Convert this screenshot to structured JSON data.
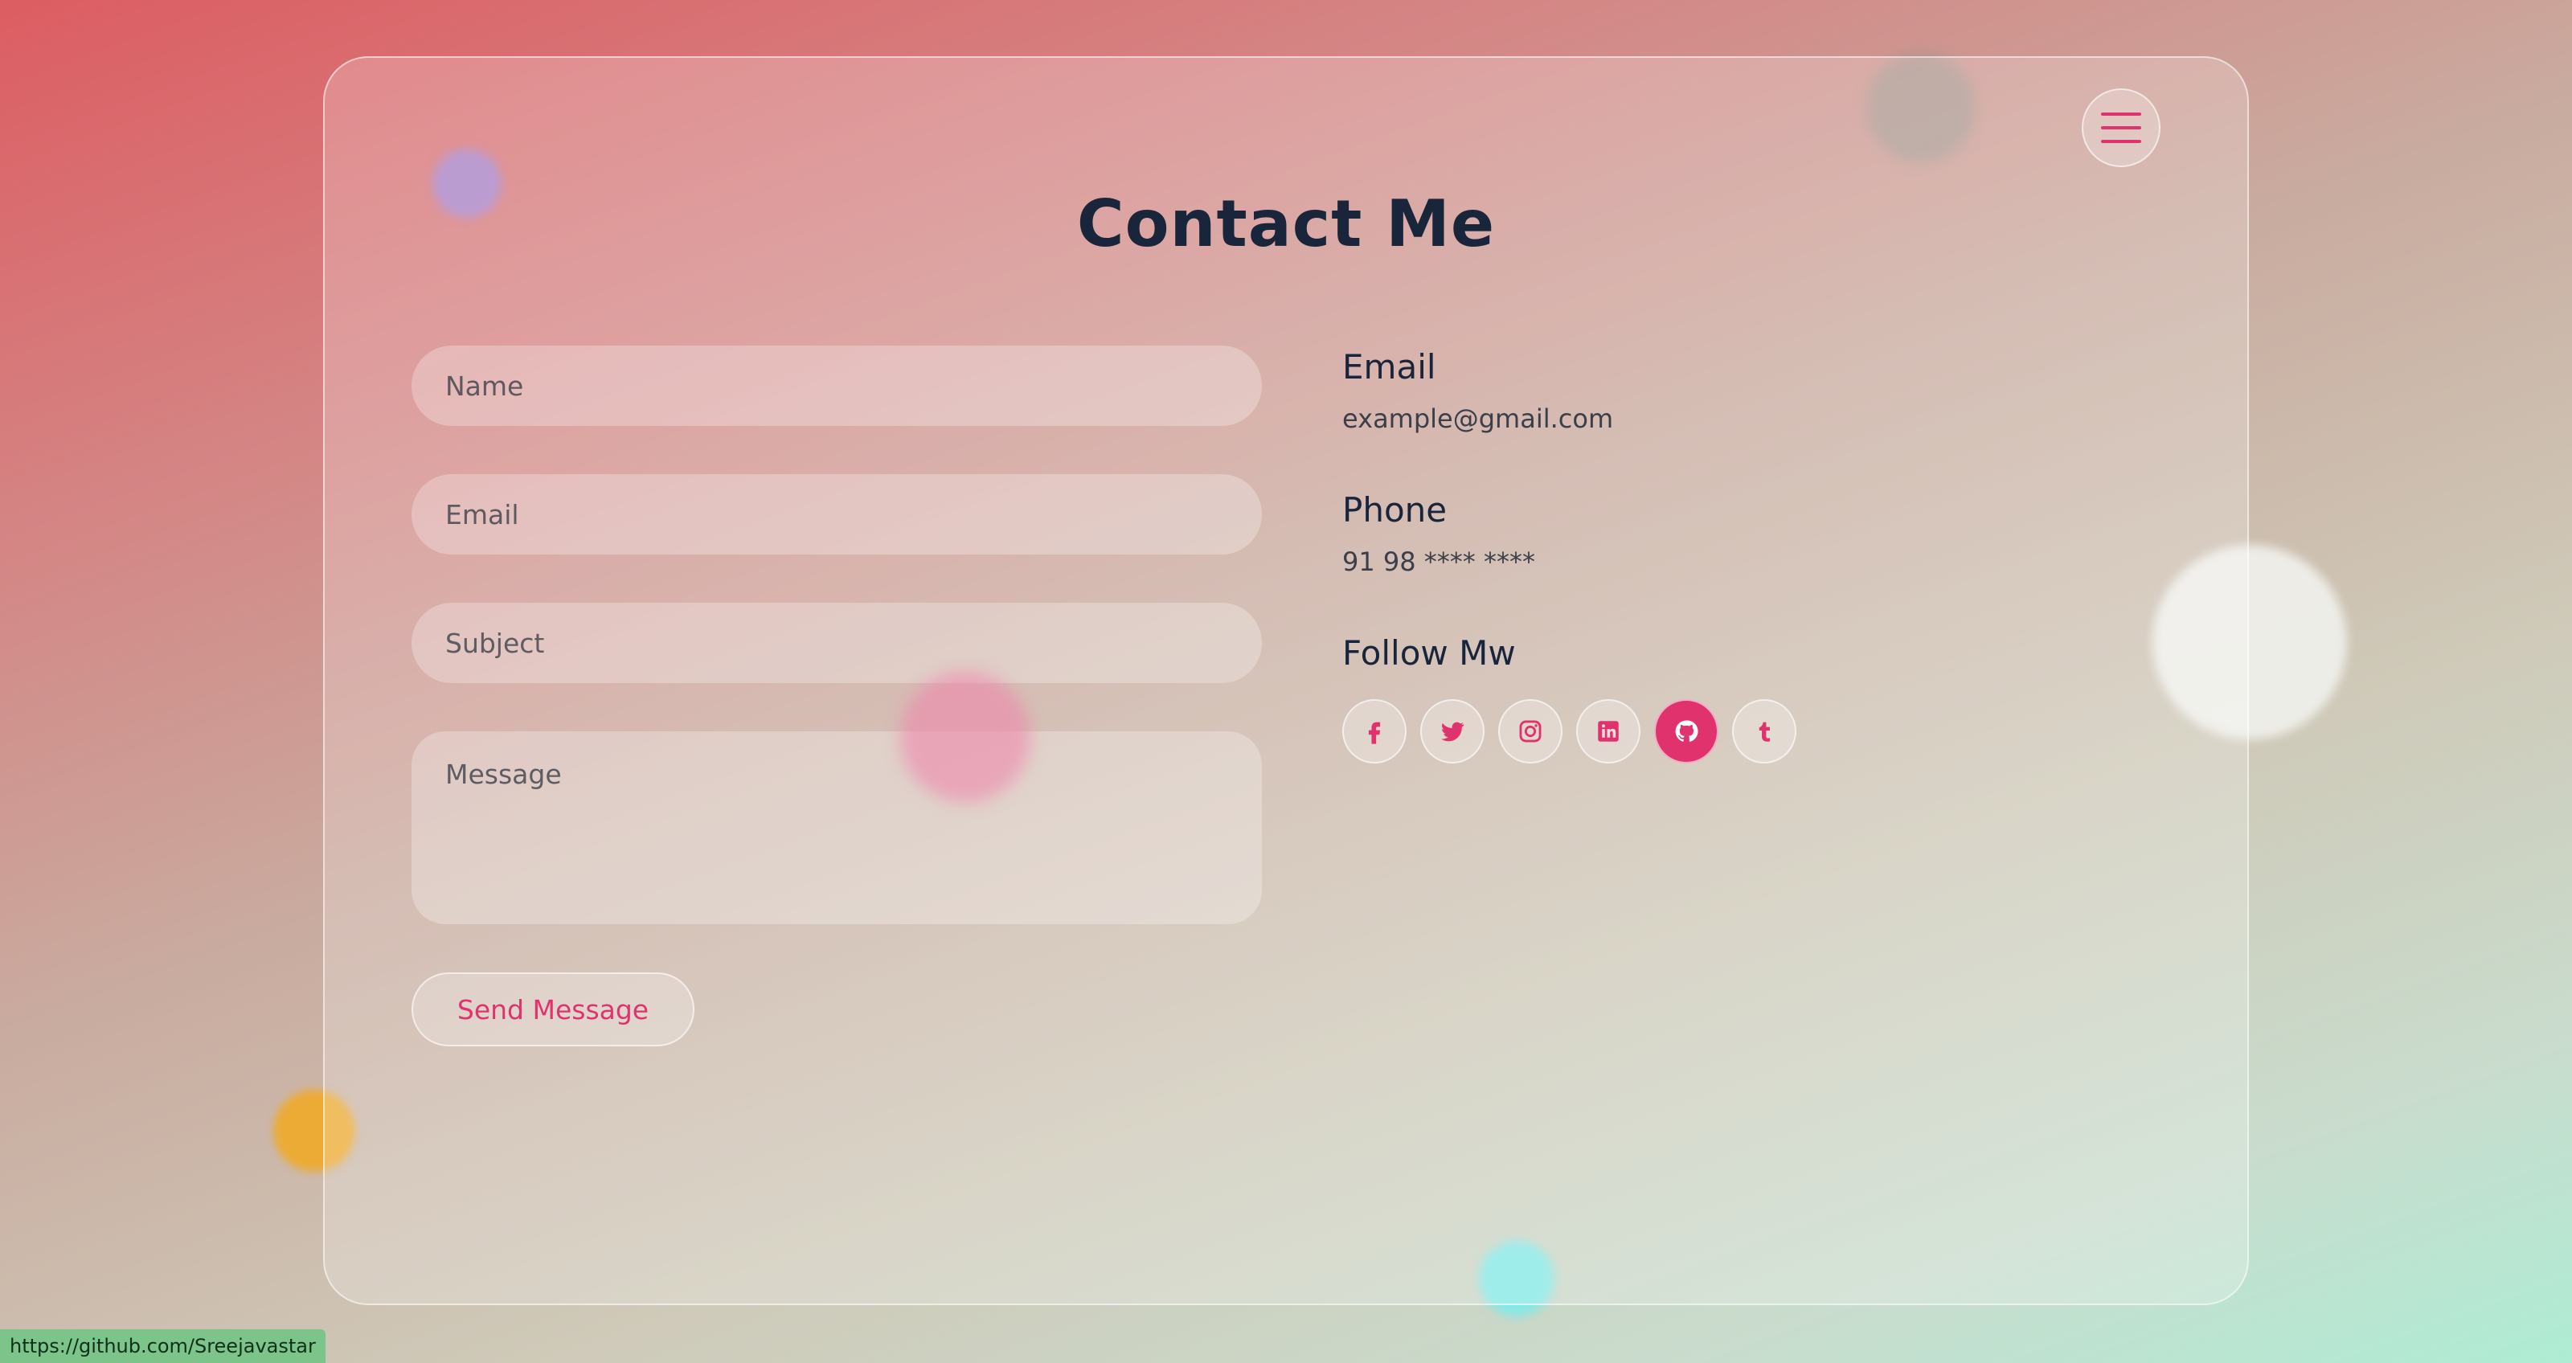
{
  "header": {
    "title": "Contact Me"
  },
  "form": {
    "name_placeholder": "Name",
    "email_placeholder": "Email",
    "subject_placeholder": "Subject",
    "message_placeholder": "Message",
    "submit_label": "Send Message"
  },
  "contact_info": {
    "email_heading": "Email",
    "email_value": "example@gmail.com",
    "phone_heading": "Phone",
    "phone_value": "91 98 **** ****",
    "follow_heading": "Follow Mw"
  },
  "social": [
    {
      "icon": "facebook-icon",
      "active": false
    },
    {
      "icon": "twitter-icon",
      "active": false
    },
    {
      "icon": "instagram-icon",
      "active": false
    },
    {
      "icon": "linkedin-icon",
      "active": false
    },
    {
      "icon": "github-icon",
      "active": true
    },
    {
      "icon": "tumblr-icon",
      "active": false
    }
  ],
  "status_bar": {
    "url": "https://github.com/Sreejavastar"
  },
  "colors": {
    "accent": "#e0336e",
    "heading": "#18253a"
  }
}
